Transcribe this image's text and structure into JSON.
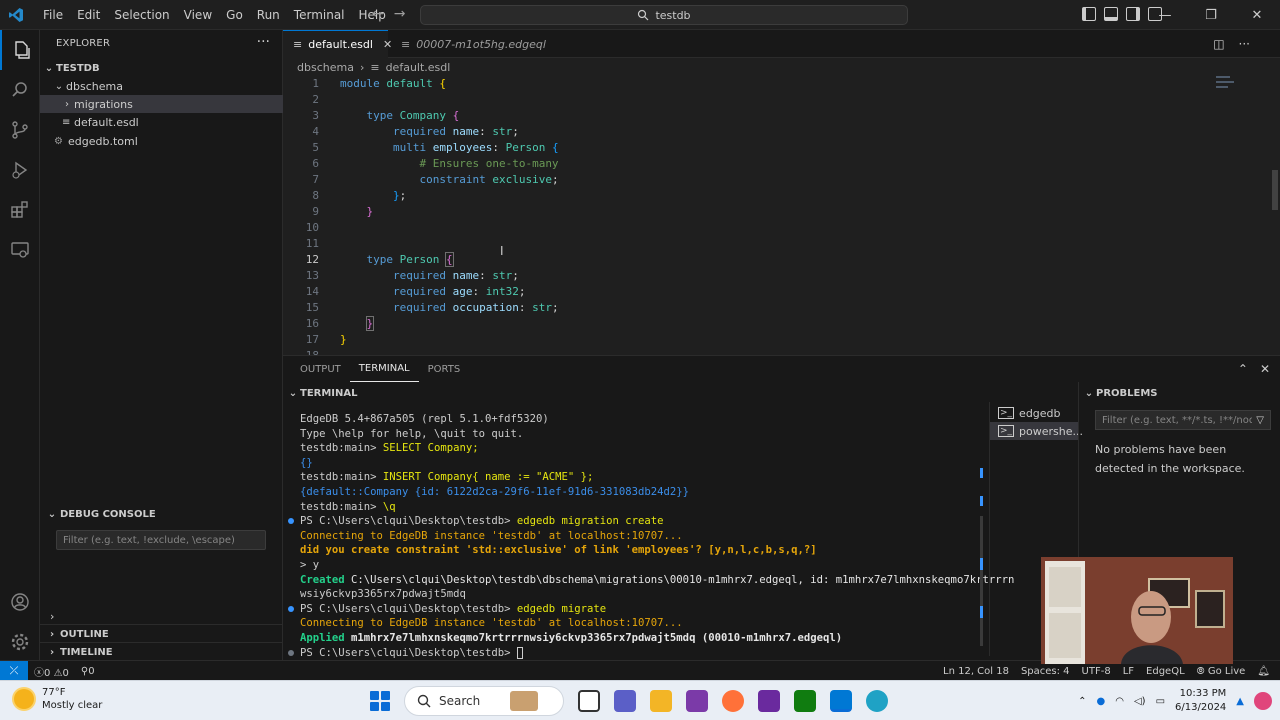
{
  "menu": [
    "File",
    "Edit",
    "Selection",
    "View",
    "Go",
    "Run",
    "Terminal",
    "Help"
  ],
  "search": {
    "label": "testdb"
  },
  "explorer": {
    "title": "EXPLORER",
    "root": "TESTDB",
    "items": [
      {
        "label": "dbschema",
        "type": "folder-open"
      },
      {
        "label": "migrations",
        "type": "folder-closed"
      },
      {
        "label": "default.esdl",
        "type": "file"
      },
      {
        "label": "edgedb.toml",
        "type": "file"
      }
    ]
  },
  "debug_console": {
    "title": "DEBUG CONSOLE",
    "filter_placeholder": "Filter (e.g. text, !exclude, \\escape)"
  },
  "outline": {
    "title": "OUTLINE"
  },
  "timeline": {
    "title": "TIMELINE"
  },
  "tabs": [
    {
      "label": "default.esdl",
      "active": true
    },
    {
      "label": "00007-m1ot5hg.edgeql",
      "active": false
    }
  ],
  "breadcrumb": [
    "dbschema",
    "default.esdl"
  ],
  "code": {
    "current_line": 12,
    "line_numbers": [
      "1",
      "2",
      "3",
      "4",
      "5",
      "6",
      "7",
      "8",
      "9",
      "10",
      "11",
      "12",
      "13",
      "14",
      "15",
      "16",
      "17",
      "18"
    ],
    "lines": [
      "module default {",
      "",
      "    type Company {",
      "        required name: str;",
      "        multi employees: Person {",
      "            # Ensures one-to-many",
      "            constraint exclusive;",
      "        };",
      "    }",
      "",
      "",
      "    type Person {",
      "        required name: str;",
      "        required age: int32;",
      "        required occupation: str;",
      "    }",
      "}",
      ""
    ]
  },
  "panel": {
    "tabs": [
      "OUTPUT",
      "TERMINAL",
      "PORTS"
    ],
    "active_tab": "TERMINAL",
    "terminal_title": "TERMINAL",
    "terminal_lines": [
      "EdgeDB 5.4+867a505 (repl 5.1.0+fdf5320)",
      "Type \\help for help, \\quit to quit.",
      "testdb:main> SELECT Company;",
      "{}",
      "testdb:main> INSERT Company{ name := \"ACME\" };",
      "{default::Company {id: 6122d2ca-29f6-11ef-91d6-331083db24d2}}",
      "testdb:main> \\q",
      "PS C:\\Users\\clqui\\Desktop\\testdb> edgedb migration create",
      "Connecting to EdgeDB instance 'testdb' at localhost:10707...",
      "did you create constraint 'std::exclusive' of link 'employees'? [y,n,l,c,b,s,q,?]",
      "> y",
      "Created C:\\Users\\clqui\\Desktop\\testdb\\dbschema\\migrations\\00010-m1mhrx7.edgeql, id: m1mhrx7e7lmhxnskeqmo7krtrrrn",
      "wsiy6ckvp3365rx7pdwajt5mdq",
      "PS C:\\Users\\clqui\\Desktop\\testdb> edgedb migrate",
      "Connecting to EdgeDB instance 'testdb' at localhost:10707...",
      "Applied m1mhrx7e7lmhxnskeqmo7krtrrrnwsiy6ckvp3365rx7pdwajt5mdq (00010-m1mhrx7.edgeql)",
      "PS C:\\Users\\clqui\\Desktop\\testdb> "
    ],
    "terminal_instances": [
      "edgedb",
      "powershe..."
    ],
    "problems_title": "PROBLEMS",
    "problems_filter_placeholder": "Filter (e.g. text, **/*.ts, !**/nod...",
    "problems_message": "No problems have been detected in the workspace."
  },
  "statusbar": {
    "errors": "0",
    "warnings": "0",
    "ports": "0",
    "cursor": "Ln 12, Col 18",
    "spaces": "Spaces: 4",
    "encoding": "UTF-8",
    "eol": "LF",
    "language": "EdgeQL",
    "golive": "Go Live"
  },
  "taskbar": {
    "temperature": "77°F",
    "weather": "Mostly clear",
    "search_label": "Search",
    "time": "10:33 PM",
    "date": "6/13/2024"
  },
  "colors": {
    "accent": "#0078d4",
    "editor_bg": "#1f1f1f",
    "sidebar_bg": "#181818"
  }
}
